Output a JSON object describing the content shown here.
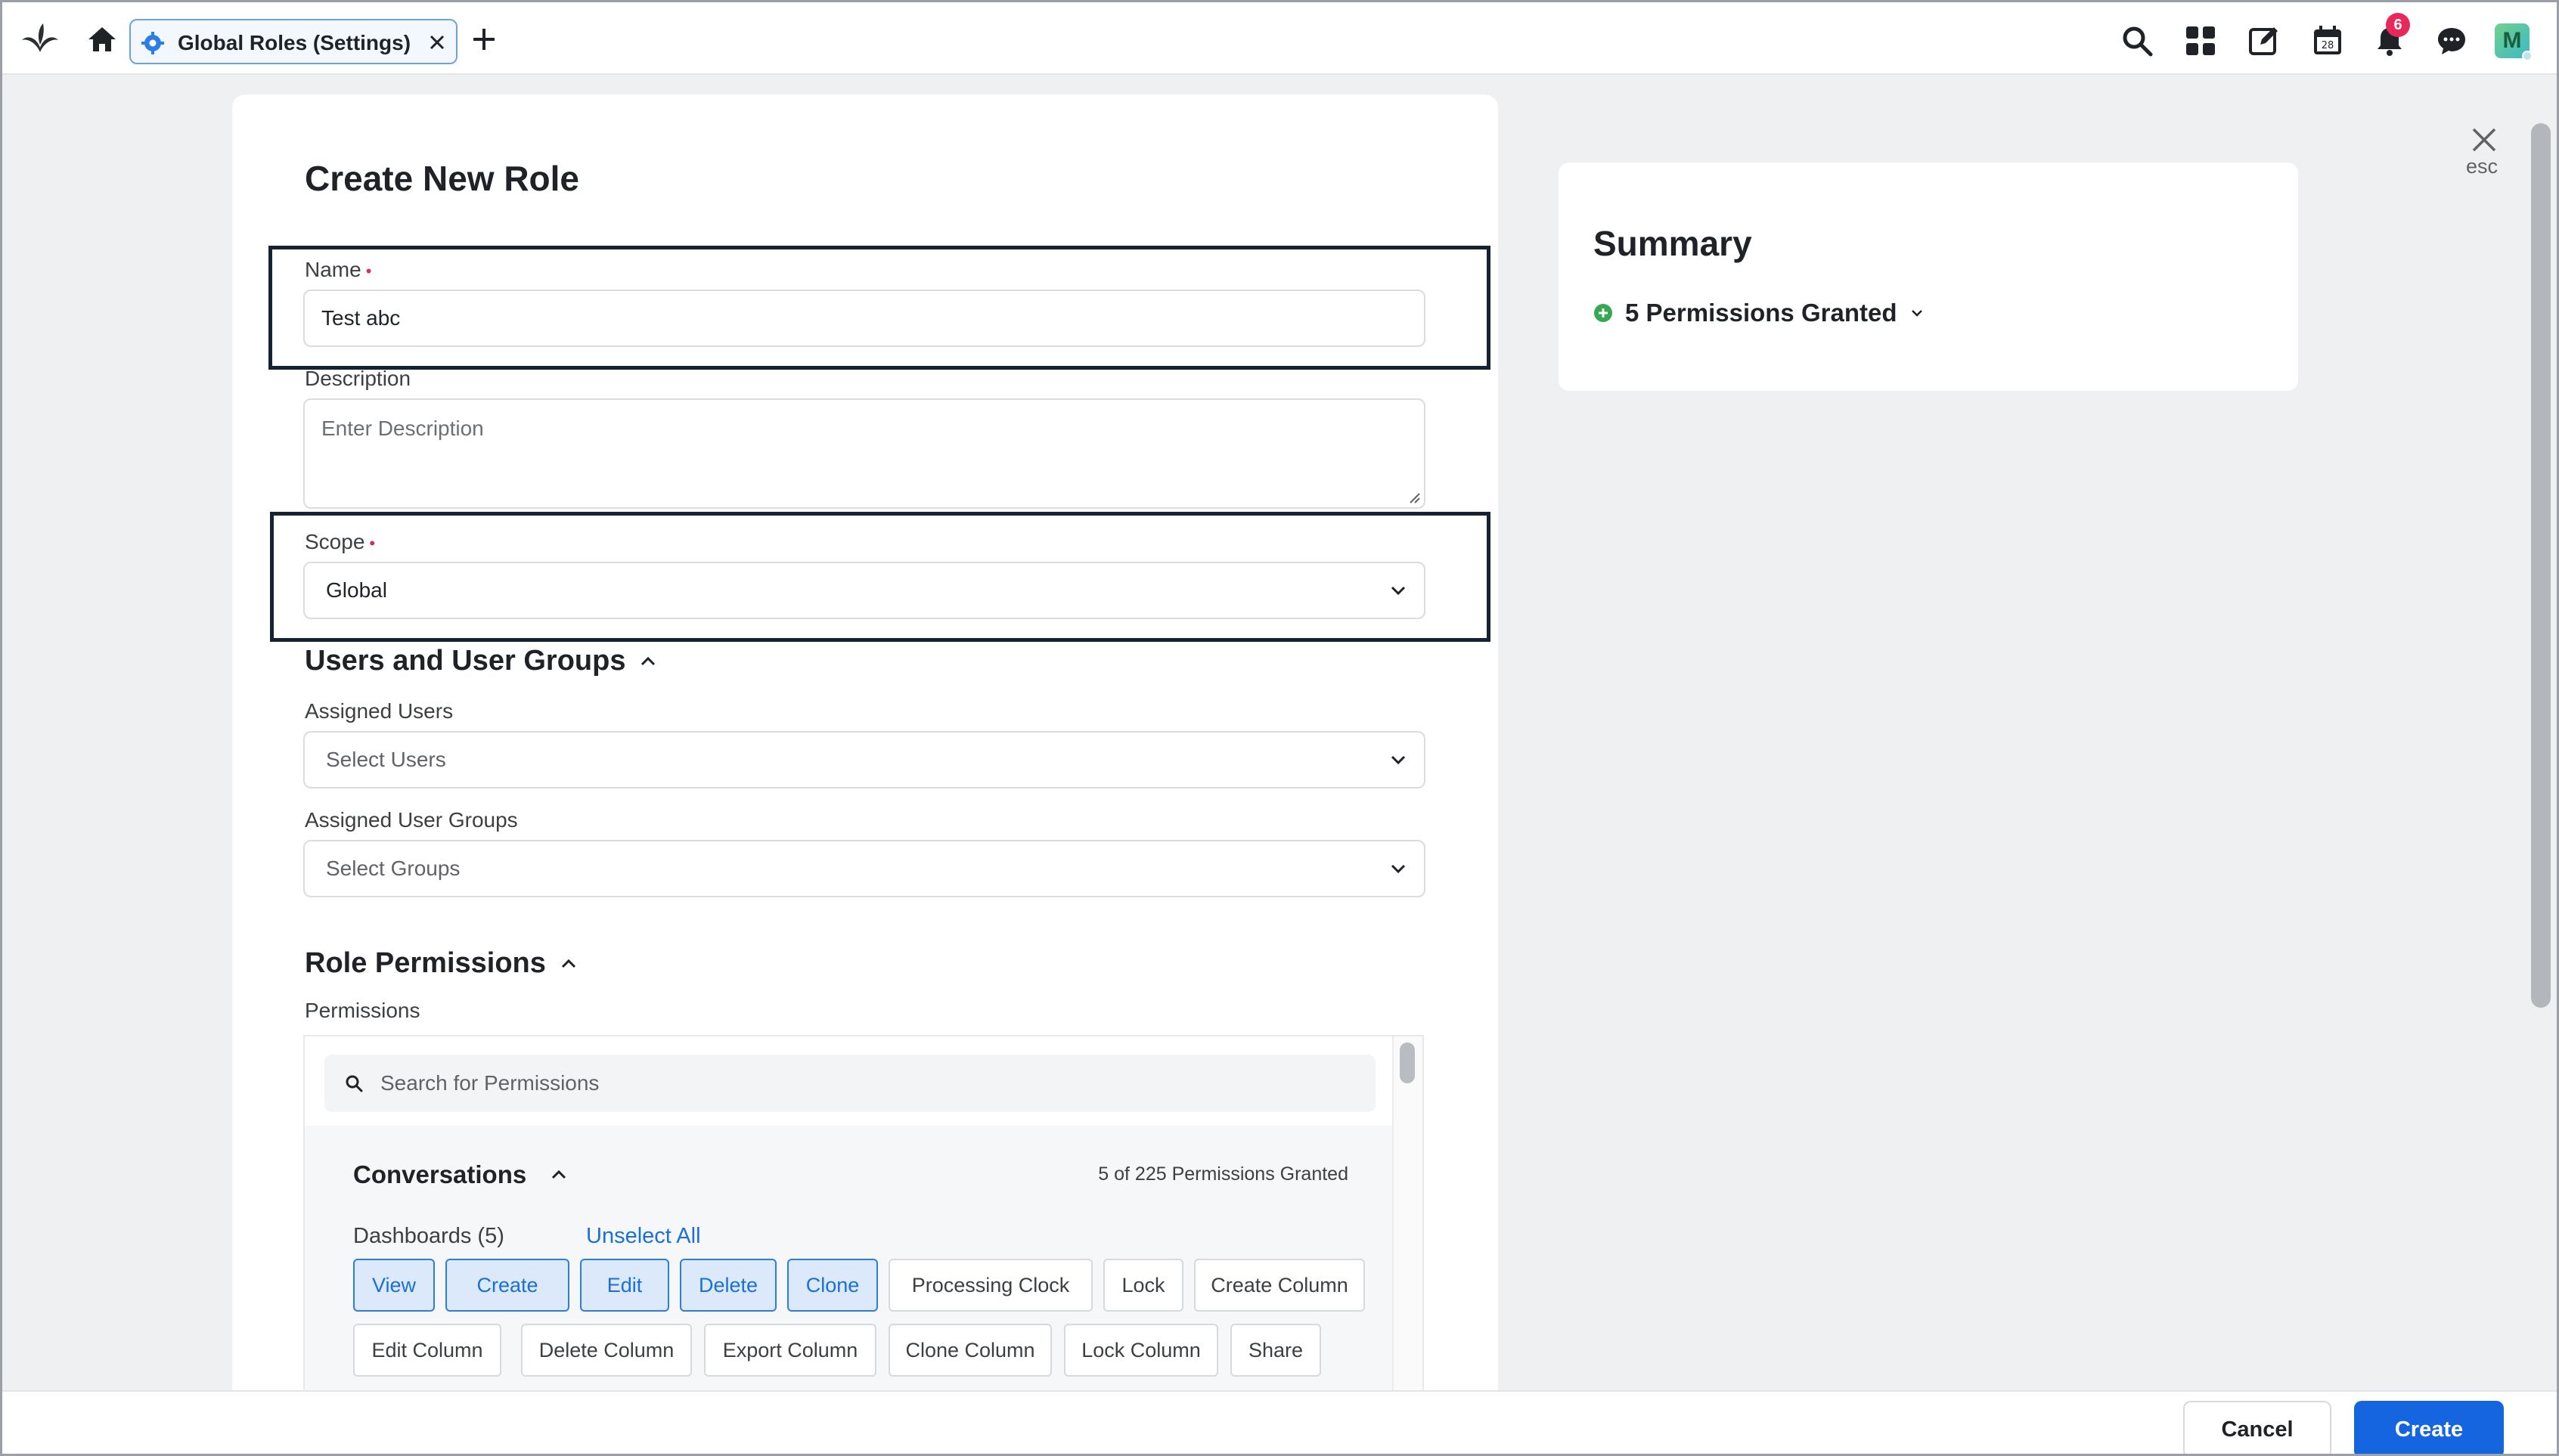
{
  "tab": {
    "title": "Global Roles (Settings)"
  },
  "notifications": {
    "count": "6"
  },
  "user": {
    "avatar_initial": "M"
  },
  "form": {
    "title": "Create New Role",
    "name": {
      "label": "Name",
      "value": "Test abc"
    },
    "description": {
      "label": "Description",
      "placeholder": "Enter Description"
    },
    "scope": {
      "label": "Scope",
      "value": "Global"
    }
  },
  "users_section": {
    "title": "Users and User Groups",
    "assigned_users": {
      "label": "Assigned Users",
      "placeholder": "Select Users"
    },
    "assigned_groups": {
      "label": "Assigned User Groups",
      "placeholder": "Select Groups"
    }
  },
  "permissions_section": {
    "title": "Role Permissions",
    "label": "Permissions",
    "search_placeholder": "Search for Permissions",
    "group": {
      "title": "Conversations",
      "count_text": "5 of 225 Permissions Granted",
      "sub_label": "Dashboards (5)",
      "unselect_label": "Unselect All",
      "chips_row1": [
        {
          "label": "View",
          "selected": true
        },
        {
          "label": "Create",
          "selected": true
        },
        {
          "label": "Edit",
          "selected": true
        },
        {
          "label": "Delete",
          "selected": true
        },
        {
          "label": "Clone",
          "selected": true
        },
        {
          "label": "Processing Clock",
          "selected": false
        },
        {
          "label": "Lock",
          "selected": false
        },
        {
          "label": "Create Column",
          "selected": false
        }
      ],
      "chips_row2": [
        {
          "label": "Edit Column",
          "selected": false
        },
        {
          "label": "Delete Column",
          "selected": false
        },
        {
          "label": "Export Column",
          "selected": false
        },
        {
          "label": "Clone Column",
          "selected": false
        },
        {
          "label": "Lock Column",
          "selected": false
        },
        {
          "label": "Share",
          "selected": false
        }
      ]
    }
  },
  "summary": {
    "title": "Summary",
    "granted_text": "5 Permissions Granted"
  },
  "close": {
    "label": "esc"
  },
  "footer": {
    "cancel_label": "Cancel",
    "create_label": "Create"
  },
  "colors": {
    "accent": "#1565e0",
    "chip_selected_bg": "#dbe9fb",
    "highlight_border": "#142233",
    "granted_green": "#34a853"
  }
}
